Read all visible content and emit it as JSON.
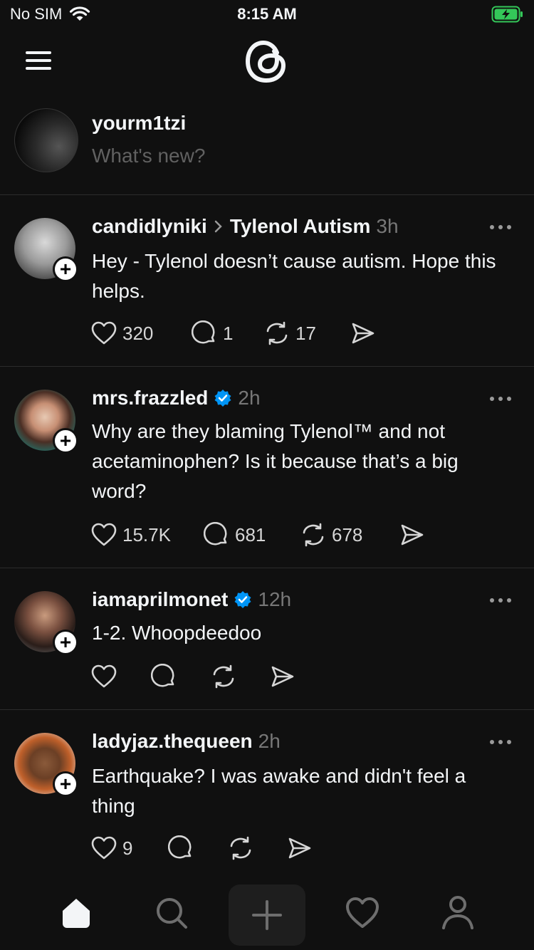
{
  "status_bar": {
    "carrier": "No SIM",
    "time": "8:15 AM"
  },
  "composer": {
    "username": "yourm1tzi",
    "placeholder": "What's new?"
  },
  "posts": [
    {
      "username": "candidlyniki",
      "reply_to": "Tylenol Autism",
      "time": "3h",
      "verified": false,
      "text": "Hey - Tylenol doesn’t cause autism. Hope this helps.",
      "likes": "320",
      "replies": "1",
      "reposts": "17"
    },
    {
      "username": "mrs.frazzled",
      "time": "2h",
      "verified": true,
      "text": "Why are they blaming Tylenol™ and not acetaminophen? Is it because that’s a big word?",
      "likes": "15.7K",
      "replies": "681",
      "reposts": "678"
    },
    {
      "username": "iamaprilmonet",
      "time": "12h",
      "verified": true,
      "text": "1-2.  Whoopdeedoo",
      "likes": "",
      "replies": "",
      "reposts": ""
    },
    {
      "username": "ladyjaz.thequeen",
      "time": "2h",
      "verified": false,
      "text": "Earthquake?  I was awake and didn't feel a thing",
      "likes": "9",
      "replies": "",
      "reposts": ""
    }
  ],
  "colors": {
    "background": "#101010",
    "text": "#f3f5f7",
    "muted": "#777777",
    "verified": "#0095f6",
    "battery": "#34c759"
  },
  "icons": {
    "menu": "hamburger-icon",
    "logo": "threads-logo",
    "like": "heart-icon",
    "reply": "comment-icon",
    "repost": "repost-icon",
    "share": "send-icon",
    "nav": [
      "home-icon",
      "search-icon",
      "plus-icon",
      "heart-icon",
      "profile-icon"
    ]
  }
}
